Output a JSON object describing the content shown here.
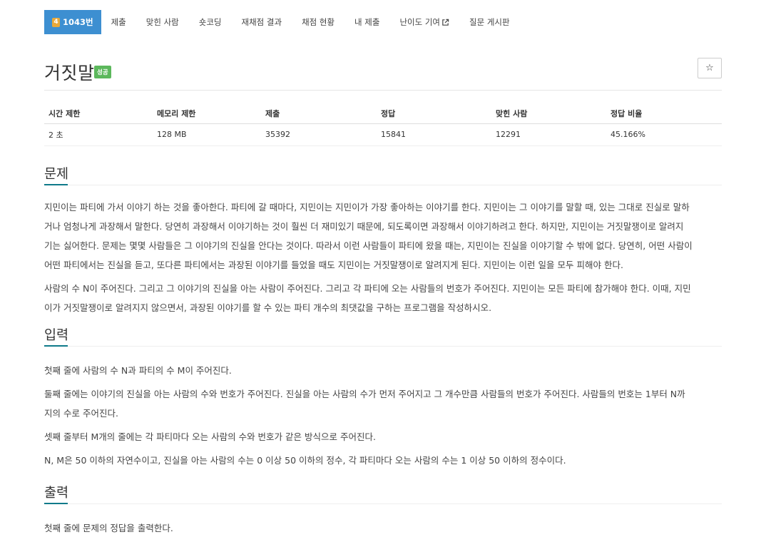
{
  "nav": {
    "problem_number": "1043번",
    "tier_number": "4",
    "items": [
      "제출",
      "맞힌 사람",
      "숏코딩",
      "재채점 결과",
      "채점 현황",
      "내 제출",
      "난이도 기여",
      "질문 게시판"
    ]
  },
  "header": {
    "title": "거짓말",
    "result_badge": "성공",
    "star_label": "☆"
  },
  "stats": {
    "headers": [
      "시간 제한",
      "메모리 제한",
      "제출",
      "정답",
      "맞힌 사람",
      "정답 비율"
    ],
    "values": [
      "2 초",
      "128 MB",
      "35392",
      "15841",
      "12291",
      "45.166%"
    ]
  },
  "problem": {
    "title": "문제",
    "lines": [
      "지민이는 파티에 가서 이야기 하는 것을 좋아한다. 파티에 갈 때마다, 지민이는 지민이가 가장 좋아하는 이야기를 한다. 지민이는 그 이야기를 말할 때, 있는 그대로 진실로 말하",
      "거나 엄청나게 과장해서 말한다. 당연히 과장해서 이야기하는 것이 훨씬 더 재미있기 때문에, 되도록이면 과장해서 이야기하려고 한다. 하지만, 지민이는 거짓말쟁이로 알려지",
      "기는 싫어한다. 문제는 몇몇 사람들은 그 이야기의 진실을 안다는 것이다. 따라서 이런 사람들이 파티에 왔을 때는, 지민이는 진실을 이야기할 수 밖에 없다. 당연히, 어떤 사람이",
      "어떤 파티에서는 진실을 듣고, 또다른 파티에서는 과장된 이야기를 들었을 때도 지민이는 거짓말쟁이로 알려지게 된다. 지민이는 이런 일을 모두 피해야 한다."
    ],
    "lines2": [
      "사람의 수 N이 주어진다. 그리고 그 이야기의 진실을 아는 사람이 주어진다. 그리고 각 파티에 오는 사람들의 번호가 주어진다. 지민이는 모든 파티에 참가해야 한다. 이때, 지민",
      "이가 거짓말쟁이로 알려지지 않으면서, 과장된 이야기를 할 수 있는 파티 개수의 최댓값을 구하는 프로그램을 작성하시오."
    ]
  },
  "input": {
    "title": "입력",
    "p1": "첫째 줄에 사람의 수 N과 파티의 수 M이 주어진다.",
    "p2_lines": [
      "둘째 줄에는 이야기의 진실을 아는 사람의 수와 번호가 주어진다. 진실을 아는 사람의 수가 먼저 주어지고 그 개수만큼 사람들의 번호가 주어진다. 사람들의 번호는 1부터 N까",
      "지의 수로 주어진다."
    ],
    "p3": "셋째 줄부터 M개의 줄에는 각 파티마다 오는 사람의 수와 번호가 같은 방식으로 주어진다.",
    "p4": "N, M은 50 이하의 자연수이고, 진실을 아는 사람의 수는 0 이상 50 이하의 정수, 각 파티마다 오는 사람의 수는 1 이상 50 이하의 정수이다."
  },
  "output": {
    "title": "출력",
    "p1": "첫째 줄에 문제의 정답을 출력한다."
  },
  "colors": {
    "active_tab": "#3d8fd1",
    "tier_badge": "#e8a93a",
    "result_badge": "#5cb85c",
    "section_underline": "#0f7a8a"
  }
}
